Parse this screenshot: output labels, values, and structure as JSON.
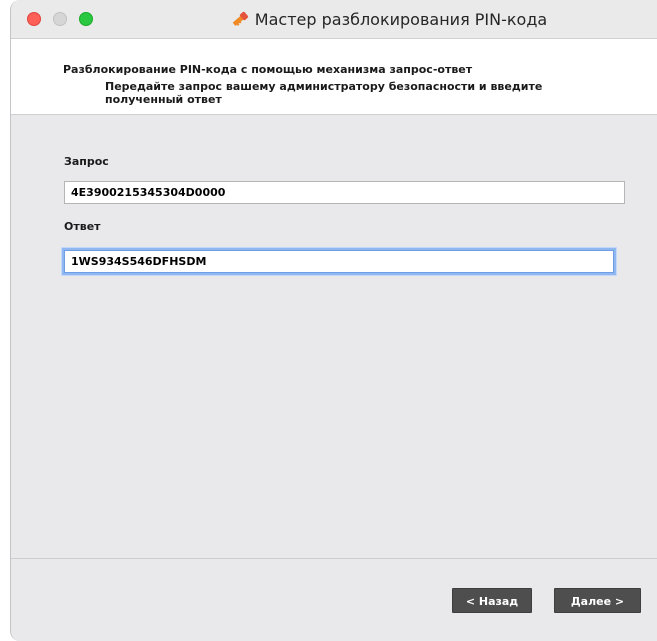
{
  "window": {
    "title": "Мастер разблокирования PIN-кода",
    "title_icon": "key-icon"
  },
  "header": {
    "title": "Разблокирование PIN-кода с помощью механизма запрос-ответ",
    "description": "Передайте запрос вашему администратору безопасности и введите полученный ответ"
  },
  "form": {
    "request_label": "Запрос",
    "request_value": "4E3900215345304D0000",
    "response_label": "Ответ",
    "response_value": "1WS934S546DFHSDM"
  },
  "buttons": {
    "back_label": "< Назад",
    "next_label": "Далее >"
  },
  "colors": {
    "close": "#fe5f57",
    "zoom": "#2ac840",
    "button_bg": "#4e4e4e",
    "focus_ring": "#8fb8f3"
  }
}
